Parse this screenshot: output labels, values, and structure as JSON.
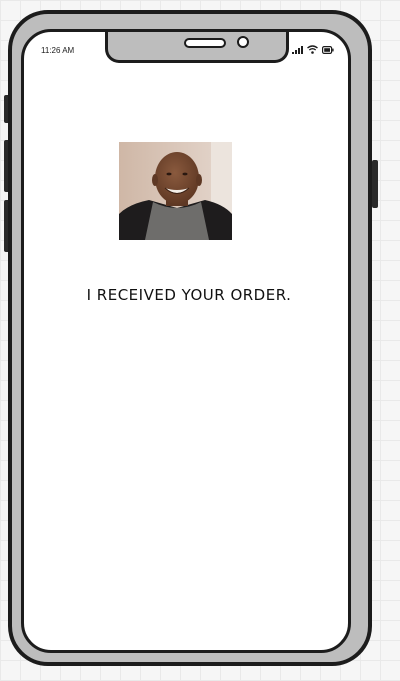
{
  "status_bar": {
    "time": "11:26 AM",
    "icons": [
      "cellular-signal-icon",
      "wifi-icon",
      "battery-icon"
    ]
  },
  "profile_photo": {
    "icon": "person-photo-icon"
  },
  "message": {
    "text": "I RECEIVED YOUR ORDER."
  },
  "colors": {
    "frame": "#1c1c1c",
    "bezel": "#bdbdbd",
    "screen": "#ffffff",
    "text": "#111111"
  }
}
